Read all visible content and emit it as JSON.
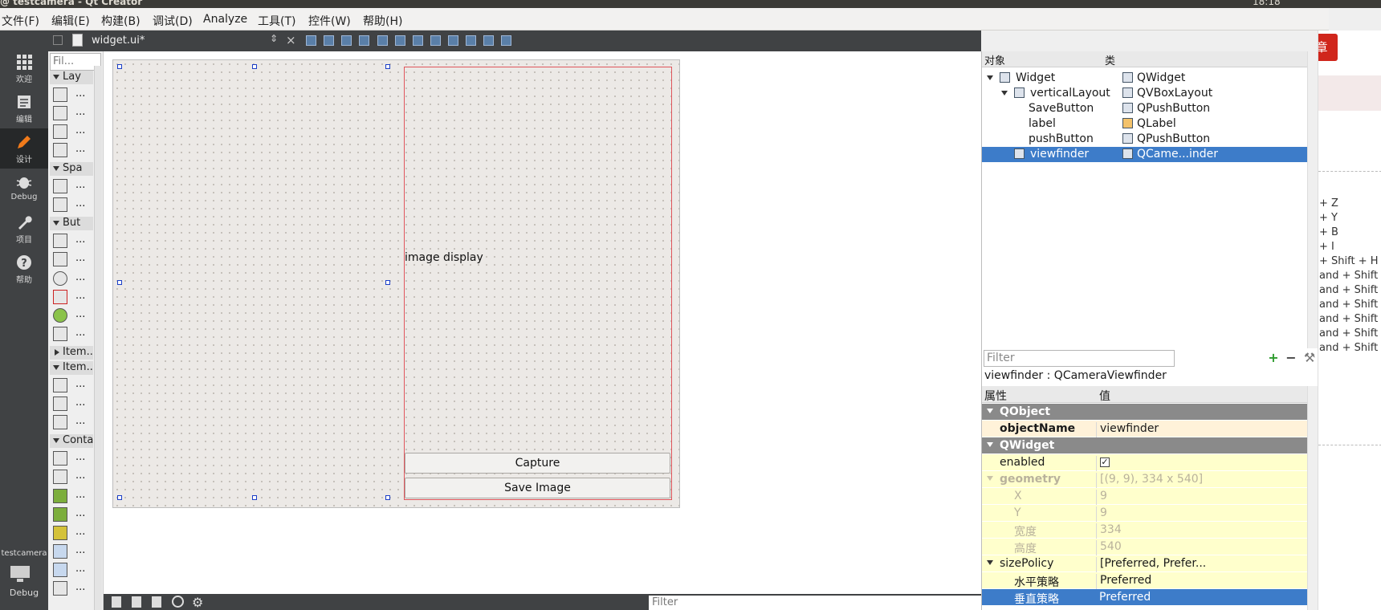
{
  "window": {
    "title": "@ testcamera - Qt Creator",
    "tray_time": "18:18"
  },
  "menu": [
    {
      "label": "文件(F)"
    },
    {
      "label": "编辑(E)"
    },
    {
      "label": "构建(B)"
    },
    {
      "label": "调试(D)"
    },
    {
      "label": "Analyze"
    },
    {
      "label": "工具(T)"
    },
    {
      "label": "控件(W)"
    },
    {
      "label": "帮助(H)"
    }
  ],
  "modes": [
    {
      "label": "欢迎",
      "icon": "grid-icon"
    },
    {
      "label": "编辑",
      "icon": "document-icon"
    },
    {
      "label": "设计",
      "icon": "pencil-icon"
    },
    {
      "label": "Debug",
      "icon": "bug-icon"
    },
    {
      "label": "项目",
      "icon": "wrench-icon"
    },
    {
      "label": "帮助",
      "icon": "help-icon"
    }
  ],
  "kit": {
    "project": "testcamera",
    "mode": "Debug"
  },
  "editor": {
    "file": "widget.ui*",
    "close": "×"
  },
  "widgetbox": {
    "filter_placeholder": "Fil...",
    "cats": [
      "Lay",
      "Spa",
      "But",
      "Item...",
      "Item...",
      "Conta"
    ],
    "dots": "..."
  },
  "form": {
    "label_text": "image display",
    "capture": "Capture",
    "save": "Save Image"
  },
  "bottom": {
    "filter": "Filter"
  },
  "object_inspector": {
    "col_object": "对象",
    "col_class": "类",
    "rows": [
      {
        "name": "Widget",
        "cls": "QWidget"
      },
      {
        "name": "verticalLayout",
        "cls": "QVBoxLayout"
      },
      {
        "name": "SaveButton",
        "cls": "QPushButton"
      },
      {
        "name": "label",
        "cls": "QLabel"
      },
      {
        "name": "pushButton",
        "cls": "QPushButton"
      },
      {
        "name": "viewfinder",
        "cls": "QCame...inder"
      }
    ]
  },
  "property_editor": {
    "filter_placeholder": "Filter",
    "title": "viewfinder : QCameraViewfinder",
    "col_prop": "属性",
    "col_value": "值",
    "rows": [
      {
        "key": "QObject",
        "val": ""
      },
      {
        "key": "objectName",
        "val": "viewfinder"
      },
      {
        "key": "QWidget",
        "val": ""
      },
      {
        "key": "enabled",
        "val": "✓"
      },
      {
        "key": "geometry",
        "val": "[(9, 9), 334 x 540]"
      },
      {
        "key": "X",
        "val": "9"
      },
      {
        "key": "Y",
        "val": "9"
      },
      {
        "key": "宽度",
        "val": "334"
      },
      {
        "key": "高度",
        "val": "540"
      },
      {
        "key": "sizePolicy",
        "val": "[Preferred, Prefer..."
      },
      {
        "key": "水平策略",
        "val": "Preferred"
      },
      {
        "key": "垂直策略",
        "val": "Preferred"
      }
    ]
  },
  "right_panel": {
    "button": "章",
    "shortcuts": [
      "+ Z",
      "+ Y",
      "+ B",
      "+ I",
      "+ Shift + H",
      "and + Shift",
      "and + Shift",
      "and + Shift",
      "and + Shift",
      "and + Shift",
      "and + Shift"
    ]
  }
}
